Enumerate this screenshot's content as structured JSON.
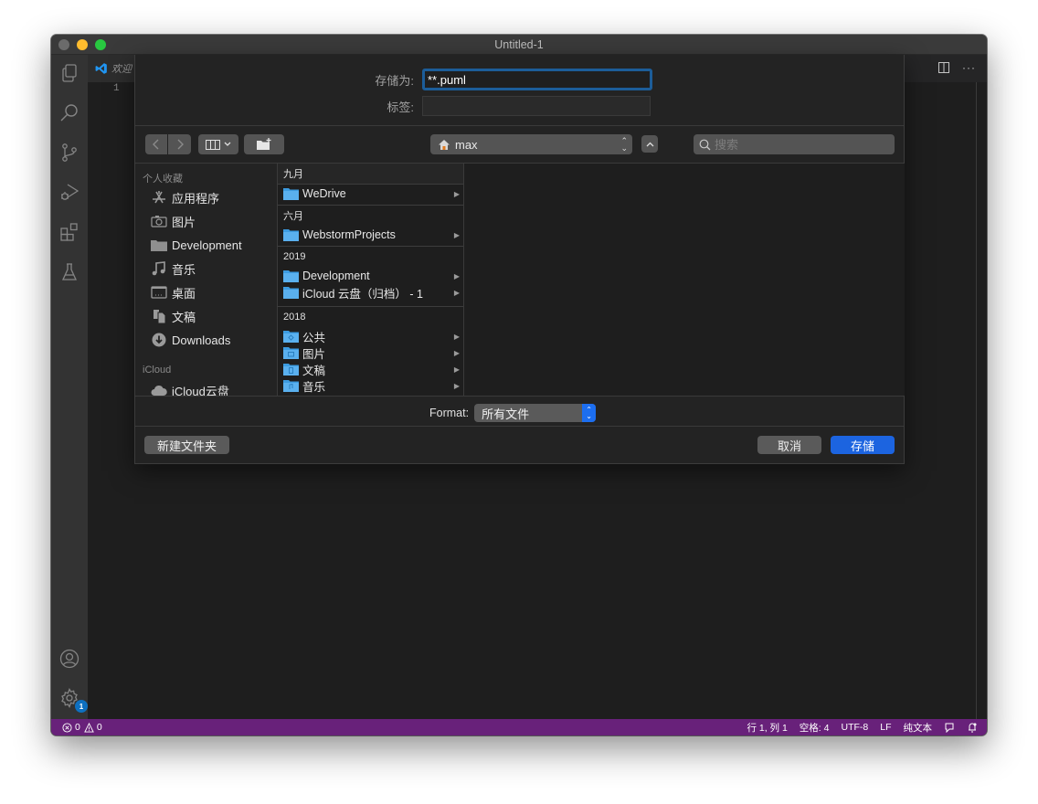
{
  "window": {
    "title": "Untitled-1"
  },
  "editor": {
    "tab_label": "欢迎",
    "line_numbers": [
      "1"
    ]
  },
  "activity_bar": {
    "items": [
      "explorer",
      "search",
      "source-control",
      "run-debug",
      "extensions",
      "testing"
    ],
    "bottom": [
      "accounts",
      "manage"
    ],
    "manage_badge": "1"
  },
  "save_dialog": {
    "save_as_label": "存储为:",
    "save_as_value": "**.puml",
    "tags_label": "标签:",
    "tags_value": "",
    "location": "max",
    "search_placeholder": "搜索",
    "sidebar": {
      "favorites_header": "个人收藏",
      "favorites": [
        {
          "label": "应用程序",
          "icon": "applications-icon"
        },
        {
          "label": "图片",
          "icon": "camera-icon"
        },
        {
          "label": "Development",
          "icon": "folder-icon"
        },
        {
          "label": "音乐",
          "icon": "music-note-icon"
        },
        {
          "label": "桌面",
          "icon": "desktop-icon"
        },
        {
          "label": "文稿",
          "icon": "documents-icon"
        },
        {
          "label": "Downloads",
          "icon": "download-icon"
        }
      ],
      "icloud_header": "iCloud",
      "icloud": [
        {
          "label": "iCloud云盘",
          "icon": "cloud-icon"
        }
      ]
    },
    "groups": [
      {
        "header": "九月",
        "items": [
          "WeDrive"
        ]
      },
      {
        "header": "六月",
        "items": [
          "WebstormProjects"
        ]
      },
      {
        "header": "2019",
        "items": [
          "Development",
          "iCloud 云盘（归档） - 1"
        ]
      },
      {
        "header": "2018",
        "items": [
          "公共",
          "图片",
          "文稿",
          "音乐"
        ]
      }
    ],
    "format_label": "Format:",
    "format_value": "所有文件",
    "new_folder_button": "新建文件夹",
    "cancel_button": "取消",
    "save_button": "存储"
  },
  "status_bar": {
    "errors": "0",
    "warnings": "0",
    "position": "行 1, 列 1",
    "spaces": "空格: 4",
    "encoding": "UTF-8",
    "eol": "LF",
    "language": "纯文本",
    "color": "#68217a"
  }
}
